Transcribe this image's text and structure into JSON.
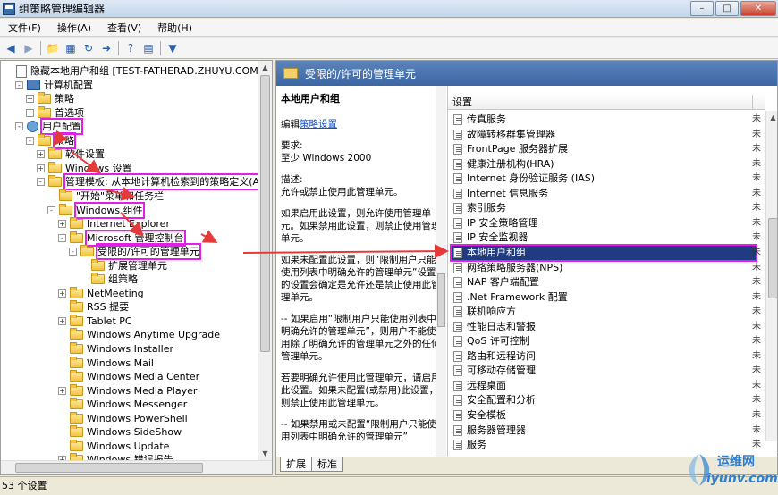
{
  "window": {
    "title": "组策略管理编辑器"
  },
  "menu": [
    "文件(F)",
    "操作(A)",
    "查看(V)",
    "帮助(H)"
  ],
  "tree": [
    {
      "label": "隐藏本地用户和组 [TEST-FATHERAD.ZHUYU.COM] 策略",
      "icon": "doc",
      "exp": "",
      "indent": 0
    },
    {
      "label": "计算机配置",
      "icon": "pc",
      "exp": "-",
      "indent": 1
    },
    {
      "label": "策略",
      "icon": "folder",
      "exp": "+",
      "indent": 2
    },
    {
      "label": "首选项",
      "icon": "folder",
      "exp": "+",
      "indent": 2
    },
    {
      "label": "用户配置",
      "icon": "usr",
      "exp": "-",
      "indent": 1,
      "hl": true
    },
    {
      "label": "策略",
      "icon": "folder",
      "exp": "-",
      "indent": 2,
      "hl": true
    },
    {
      "label": "软件设置",
      "icon": "folder",
      "exp": "+",
      "indent": 3
    },
    {
      "label": "Windows 设置",
      "icon": "folder",
      "exp": "+",
      "indent": 3
    },
    {
      "label": "管理模板: 从本地计算机检索到的策略定义(A",
      "icon": "folder",
      "exp": "-",
      "indent": 3,
      "hl": true
    },
    {
      "label": "\"开始\"菜单和任务栏",
      "icon": "folder",
      "exp": "",
      "indent": 4
    },
    {
      "label": "Windows 组件",
      "icon": "folder",
      "exp": "-",
      "indent": 4,
      "hl": true
    },
    {
      "label": "Internet Explorer",
      "icon": "folder",
      "exp": "+",
      "indent": 5
    },
    {
      "label": "Microsoft 管理控制台",
      "icon": "folder",
      "exp": "-",
      "indent": 5,
      "hl": true
    },
    {
      "label": "受限的/许可的管理单元",
      "icon": "folder",
      "exp": "-",
      "indent": 6,
      "hl": true
    },
    {
      "label": "扩展管理单元",
      "icon": "folder",
      "exp": "",
      "indent": 7
    },
    {
      "label": "组策略",
      "icon": "folder",
      "exp": "",
      "indent": 7
    },
    {
      "label": "NetMeeting",
      "icon": "folder",
      "exp": "+",
      "indent": 5
    },
    {
      "label": "RSS 提要",
      "icon": "folder",
      "exp": "",
      "indent": 5
    },
    {
      "label": "Tablet PC",
      "icon": "folder",
      "exp": "+",
      "indent": 5
    },
    {
      "label": "Windows Anytime Upgrade",
      "icon": "folder",
      "exp": "",
      "indent": 5
    },
    {
      "label": "Windows Installer",
      "icon": "folder",
      "exp": "",
      "indent": 5
    },
    {
      "label": "Windows Mail",
      "icon": "folder",
      "exp": "",
      "indent": 5
    },
    {
      "label": "Windows Media Center",
      "icon": "folder",
      "exp": "",
      "indent": 5
    },
    {
      "label": "Windows Media Player",
      "icon": "folder",
      "exp": "+",
      "indent": 5
    },
    {
      "label": "Windows Messenger",
      "icon": "folder",
      "exp": "",
      "indent": 5
    },
    {
      "label": "Windows PowerShell",
      "icon": "folder",
      "exp": "",
      "indent": 5
    },
    {
      "label": "Windows SideShow",
      "icon": "folder",
      "exp": "",
      "indent": 5
    },
    {
      "label": "Windows Update",
      "icon": "folder",
      "exp": "",
      "indent": 5
    },
    {
      "label": "Windows 错误报告",
      "icon": "folder",
      "exp": "+",
      "indent": 5
    }
  ],
  "right_header": "受限的/许可的管理单元",
  "desc": {
    "title": "本地用户和组",
    "edit_prefix": "编辑",
    "edit_link": "策略设置",
    "req_label": "要求:",
    "req_value": "至少 Windows 2000",
    "desc_label": "描述:",
    "p1": "允许或禁止使用此管理单元。",
    "p2": "如果启用此设置，则允许使用管理单元。如果禁用此设置，则禁止使用管理单元。",
    "p3": "如果未配置此设置，则“限制用户只能使用列表中明确允许的管理单元”设置的设置会确定是允许还是禁止使用此管理单元。",
    "p4": "-- 如果启用“限制用户只能使用列表中明确允许的管理单元”，则用户不能使用除了明确允许的管理单元之外的任何管理单元。",
    "p5": "若要明确允许使用此管理单元，请启用此设置。如果未配置(或禁用)此设置，则禁止使用此管理单元。",
    "p6": "-- 如果禁用或未配置“限制用户只能使用列表中明确允许的管理单元”"
  },
  "list": {
    "col1": "设置",
    "items": [
      {
        "label": "传真服务",
        "icon": "pico"
      },
      {
        "label": "故障转移群集管理器",
        "icon": "pico"
      },
      {
        "label": "FrontPage 服务器扩展",
        "icon": "pico"
      },
      {
        "label": "健康注册机构(HRA)",
        "icon": "pico"
      },
      {
        "label": "Internet 身份验证服务 (IAS)",
        "icon": "pico"
      },
      {
        "label": "Internet 信息服务",
        "icon": "pico"
      },
      {
        "label": "索引服务",
        "icon": "pico"
      },
      {
        "label": "IP 安全策略管理",
        "icon": "pico"
      },
      {
        "label": "IP 安全监视器",
        "icon": "pico"
      },
      {
        "label": "本地用户和组",
        "icon": "pico",
        "sel": true
      },
      {
        "label": "网络策略服务器(NPS)",
        "icon": "pico"
      },
      {
        "label": "NAP 客户端配置",
        "icon": "pico"
      },
      {
        "label": ".Net Framework 配置",
        "icon": "pico"
      },
      {
        "label": "联机响应方",
        "icon": "pico"
      },
      {
        "label": "性能日志和警报",
        "icon": "pico"
      },
      {
        "label": "QoS 许可控制",
        "icon": "pico"
      },
      {
        "label": "路由和远程访问",
        "icon": "pico"
      },
      {
        "label": "可移动存储管理",
        "icon": "pico"
      },
      {
        "label": "远程桌面",
        "icon": "pico"
      },
      {
        "label": "安全配置和分析",
        "icon": "pico"
      },
      {
        "label": "安全模板",
        "icon": "pico"
      },
      {
        "label": "服务器管理器",
        "icon": "pico"
      },
      {
        "label": "服务",
        "icon": "pico"
      }
    ],
    "state_mark": "未"
  },
  "tabs": [
    "扩展",
    "标准"
  ],
  "status": "53 个设置",
  "watermark": {
    "cn": "运维网",
    "en": "iyunv.com"
  },
  "colors": {
    "highlight": "#e21ee8",
    "selected_row": "#1f3b82",
    "header": "#3c66a3"
  }
}
